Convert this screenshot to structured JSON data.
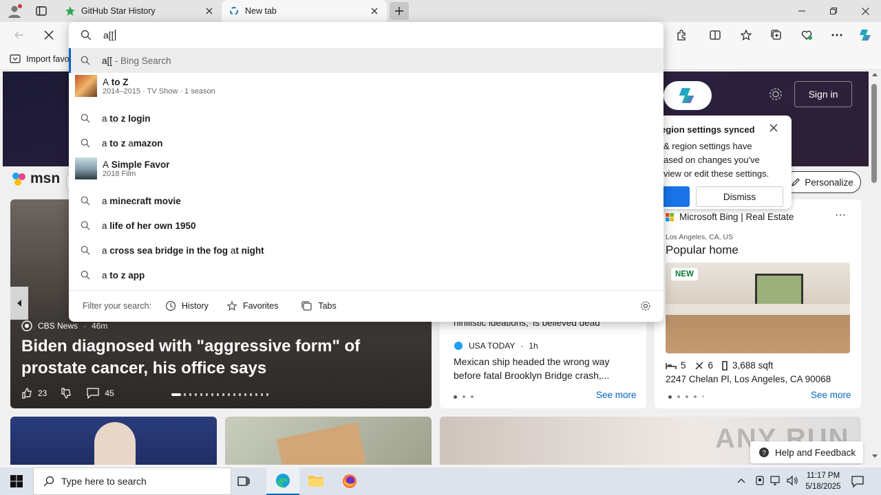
{
  "browser": {
    "tabs": [
      {
        "label": "GitHub Star History",
        "active": false
      },
      {
        "label": "New tab",
        "active": true
      }
    ],
    "address_value": "a[[",
    "favorites_bar": {
      "import_label": "Import favo"
    }
  },
  "omnibox": {
    "suggestions": [
      {
        "type": "search",
        "typed": "a[[",
        "rest": " - Bing Search"
      },
      {
        "type": "entity",
        "prefix": "A",
        "bold": " to Z",
        "sub": "2014–2015 · TV Show · 1 season"
      },
      {
        "type": "search",
        "prefix": "a",
        "bold": " to z login"
      },
      {
        "type": "search",
        "prefix": "a",
        "bold": " to z ",
        "tail_prefix": "a",
        "tail_bold": "mazon"
      },
      {
        "type": "entity",
        "prefix": "A",
        "bold": " Simple Favor",
        "sub": "2018 Film"
      },
      {
        "type": "search",
        "prefix": "a",
        "bold": " minecraft movie"
      },
      {
        "type": "search",
        "prefix": "a",
        "bold": " life of her own 1950"
      },
      {
        "type": "search",
        "prefix": "a",
        "bold": " cross sea bridge in the fog ",
        "tail_prefix": "a",
        "tail_bold": "t night"
      },
      {
        "type": "search",
        "prefix": "a",
        "bold": " to z app"
      }
    ],
    "filter": {
      "label": "Filter your search:",
      "history": "History",
      "favorites": "Favorites",
      "tabs": "Tabs"
    }
  },
  "msn": {
    "logo": "msn",
    "sign_in": "Sign in",
    "personalize": "Personalize",
    "popup": {
      "title": "egion settings synced",
      "body_lines": [
        "& region settings have",
        "ased on changes you've",
        "view or edit these settings."
      ],
      "dismiss": "Dismiss"
    },
    "main_story": {
      "source": "CBS News",
      "age": "46m",
      "headline": "Biden diagnosed with \"aggressive form\" of prostate cancer, his office says",
      "likes": "23",
      "comments": "45"
    },
    "mid_card": {
      "partial_text": "nihilistic ideations, 'is believed dead",
      "source": "USA TODAY",
      "age": "1h",
      "headline": "Mexican ship headed the wrong way before fatal Brooklyn Bridge crash,...",
      "see_more": "See more"
    },
    "real_estate": {
      "provider": "Microsoft Bing | Real Estate",
      "location": "Los Angeles, CA, US",
      "title": "Popular home",
      "badge": "NEW",
      "beds": "5",
      "baths": "6",
      "sqft": "3,688 sqft",
      "address": "2247 Chelan Pl, Los Angeles, CA 90068",
      "see_more": "See more"
    },
    "help": "Help and Feedback",
    "watermark": "ANY RUN"
  },
  "taskbar": {
    "search_placeholder": "Type here to search",
    "time": "11:17 PM",
    "date": "5/18/2025"
  },
  "colors": {
    "accent": "#0067c0",
    "bing_blue": "#1a73e8"
  }
}
